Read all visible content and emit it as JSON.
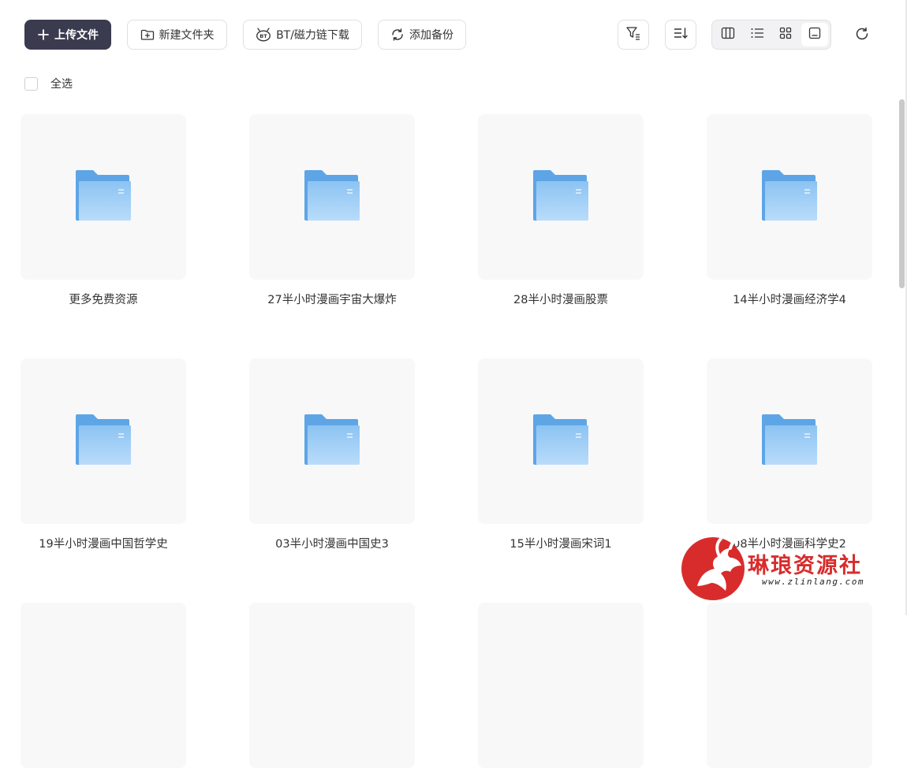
{
  "toolbar": {
    "upload_label": "上传文件",
    "new_folder_label": "新建文件夹",
    "bt_label": "BT/磁力链下载",
    "backup_label": "添加备份",
    "bt_badge": "BT"
  },
  "select_all_label": "全选",
  "view_mode": "grid-large",
  "colors": {
    "primary": "#3a3b4f",
    "folder": "#6fb2ee",
    "tile": "#f8f8f9"
  },
  "folders": [
    {
      "name": "更多免费资源"
    },
    {
      "name": "27半小时漫画宇宙大爆炸"
    },
    {
      "name": "28半小时漫画股票"
    },
    {
      "name": "14半小时漫画经济学4"
    },
    {
      "name": "19半小时漫画中国哲学史"
    },
    {
      "name": "03半小时漫画中国史3"
    },
    {
      "name": "15半小时漫画宋词1"
    },
    {
      "name": "08半小时漫画科学史2"
    }
  ],
  "watermark": {
    "title": "琳琅资源社",
    "url": "www.zlinlang.com"
  }
}
